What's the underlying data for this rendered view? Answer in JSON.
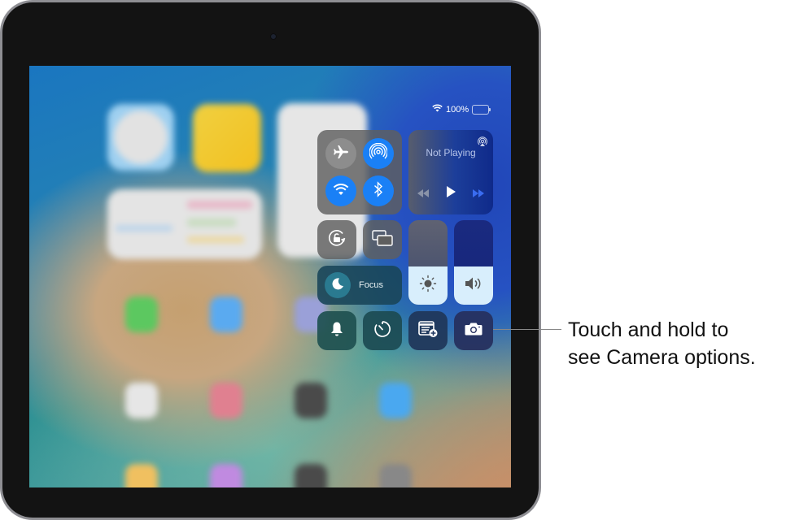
{
  "status_bar": {
    "battery_text": "100%",
    "wifi_icon": "wifi-icon",
    "battery_icon": "battery-icon",
    "battery_level": 1.0
  },
  "control_center": {
    "connectivity": [
      {
        "name": "airplane-mode",
        "icon": "airplane-icon",
        "state": "off"
      },
      {
        "name": "airdrop",
        "icon": "airdrop-icon",
        "state": "on"
      },
      {
        "name": "wifi",
        "icon": "wifi-icon",
        "state": "on"
      },
      {
        "name": "bluetooth",
        "icon": "bluetooth-icon",
        "state": "on"
      }
    ],
    "media": {
      "title": "Not Playing",
      "airplay_icon": "airplay-icon",
      "prev_icon": "rewind-icon",
      "play_icon": "play-icon",
      "next_icon": "fast-forward-icon"
    },
    "orientation_lock": {
      "icon": "rotation-lock-icon"
    },
    "screen_mirroring": {
      "icon": "screen-mirroring-icon"
    },
    "focus": {
      "label": "Focus",
      "icon": "moon-icon"
    },
    "brightness": {
      "icon": "sun-icon",
      "level": 0.45
    },
    "volume": {
      "icon": "speaker-icon",
      "level": 0.45
    },
    "bottom_row": [
      {
        "name": "silent-mode",
        "icon": "bell-icon"
      },
      {
        "name": "timer",
        "icon": "timer-icon"
      },
      {
        "name": "quick-note",
        "icon": "quick-note-icon"
      },
      {
        "name": "camera",
        "icon": "camera-icon"
      }
    ],
    "colors": {
      "active_blue": "#1a80f6",
      "inactive_gray": "#8d8d8d",
      "slider_fill": "#d8eefc"
    }
  },
  "callout": {
    "line1": "Touch and hold to",
    "line2": "see Camera options."
  }
}
